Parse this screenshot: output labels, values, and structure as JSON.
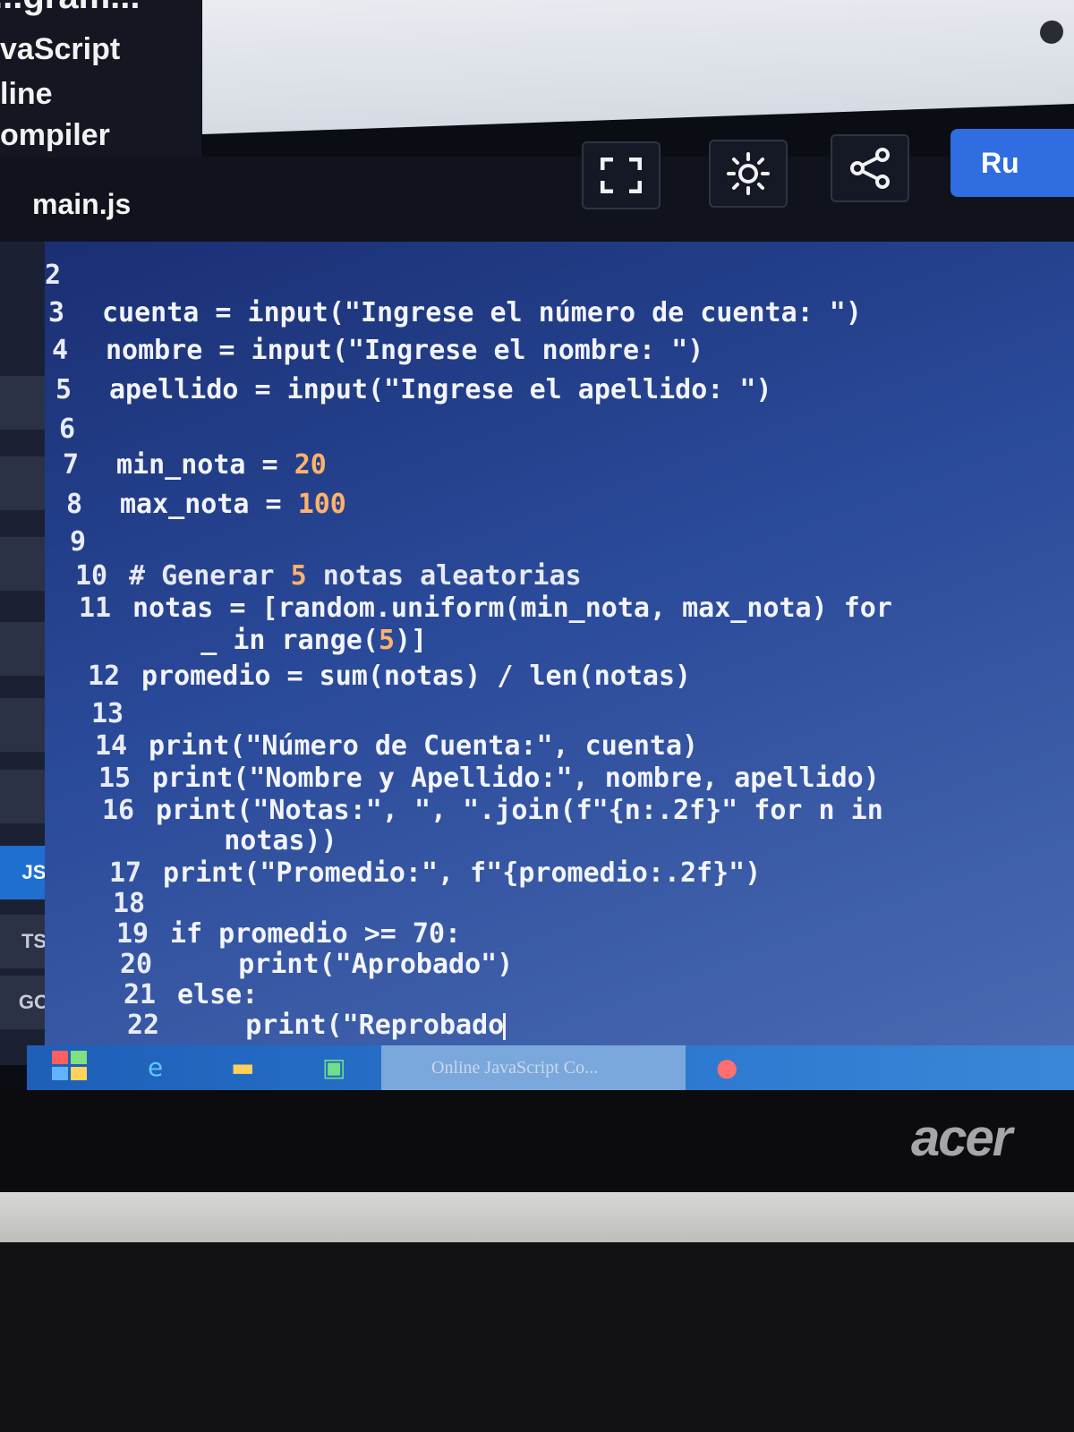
{
  "brand": {
    "line1": "...gram...",
    "line2": "vaScript",
    "line3": "line",
    "line4": "ompiler"
  },
  "editor": {
    "tab": "main.js",
    "run_label": "Ru",
    "code": [
      {
        "n": "2",
        "text": ""
      },
      {
        "n": "3",
        "text": "cuenta = input(\"Ingrese el número de cuenta: \")"
      },
      {
        "n": "4",
        "text": "nombre = input(\"Ingrese el nombre: \")"
      },
      {
        "n": "5",
        "text": "apellido = input(\"Ingrese el apellido: \")"
      },
      {
        "n": "6",
        "text": ""
      },
      {
        "n": "7",
        "text": "min_nota = 20"
      },
      {
        "n": "8",
        "text": "max_nota = 100"
      },
      {
        "n": "9",
        "text": ""
      },
      {
        "n": "10",
        "text": "# Generar 5 notas aleatorias"
      },
      {
        "n": "11",
        "text": "notas = [random.uniform(min_nota, max_nota) for"
      },
      {
        "n": "",
        "text": "    _ in range(5)]"
      },
      {
        "n": "12",
        "text": "promedio = sum(notas) / len(notas)"
      },
      {
        "n": "13",
        "text": ""
      },
      {
        "n": "14",
        "text": "print(\"Número de Cuenta:\", cuenta)"
      },
      {
        "n": "15",
        "text": "print(\"Nombre y Apellido:\", nombre, apellido)"
      },
      {
        "n": "16",
        "text": "print(\"Notas:\", \", \".join(f\"{n:.2f}\" for n in"
      },
      {
        "n": "",
        "text": "    notas))"
      },
      {
        "n": "17",
        "text": "print(\"Promedio:\", f\"{promedio:.2f}\")"
      },
      {
        "n": "18",
        "text": ""
      },
      {
        "n": "19",
        "text": "if promedio >= 70:"
      },
      {
        "n": "20",
        "text": "    print(\"Aprobado\")"
      },
      {
        "n": "21",
        "text": "else:"
      },
      {
        "n": "22",
        "text": "    print(\"Reprobado"
      }
    ]
  },
  "rail": {
    "js": "JS",
    "ts": "TS",
    "go": "GO"
  },
  "taskbar": {
    "task_label": "Online JavaScript Co..."
  },
  "laptop": {
    "logo": "acer"
  }
}
